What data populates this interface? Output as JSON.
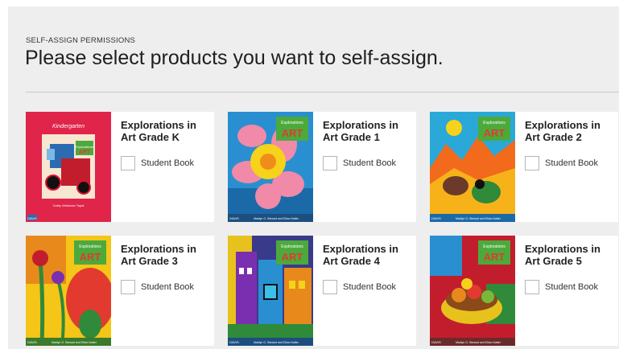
{
  "header": {
    "eyebrow": "SELF-ASSIGN PERMISSIONS",
    "title": "Please select products you want to self-assign."
  },
  "cover_text": {
    "series": "Explorations",
    "series_in": "in",
    "art": "ART",
    "kindergarten": "Kindergarten",
    "author_k": "Cathy Weisman Topal",
    "authors": "Marilyn G. Stewart and Eldon Katter",
    "publisher": "DAVIS"
  },
  "products": [
    {
      "title": "Explorations in Art Grade K",
      "option": "Student Book",
      "checked": false
    },
    {
      "title": "Explorations in Art Grade 1",
      "option": "Student Book",
      "checked": false
    },
    {
      "title": "Explorations in Art Grade 2",
      "option": "Student Book",
      "checked": false
    },
    {
      "title": "Explorations in Art Grade 3",
      "option": "Student Book",
      "checked": false
    },
    {
      "title": "Explorations in Art Grade 4",
      "option": "Student Book",
      "checked": false
    },
    {
      "title": "Explorations in Art Grade 5",
      "option": "Student Book",
      "checked": false
    }
  ],
  "colors": {
    "badge_green": "#4caa3c",
    "art_red": "#e23a2e",
    "cover_k": "#e0244a"
  }
}
